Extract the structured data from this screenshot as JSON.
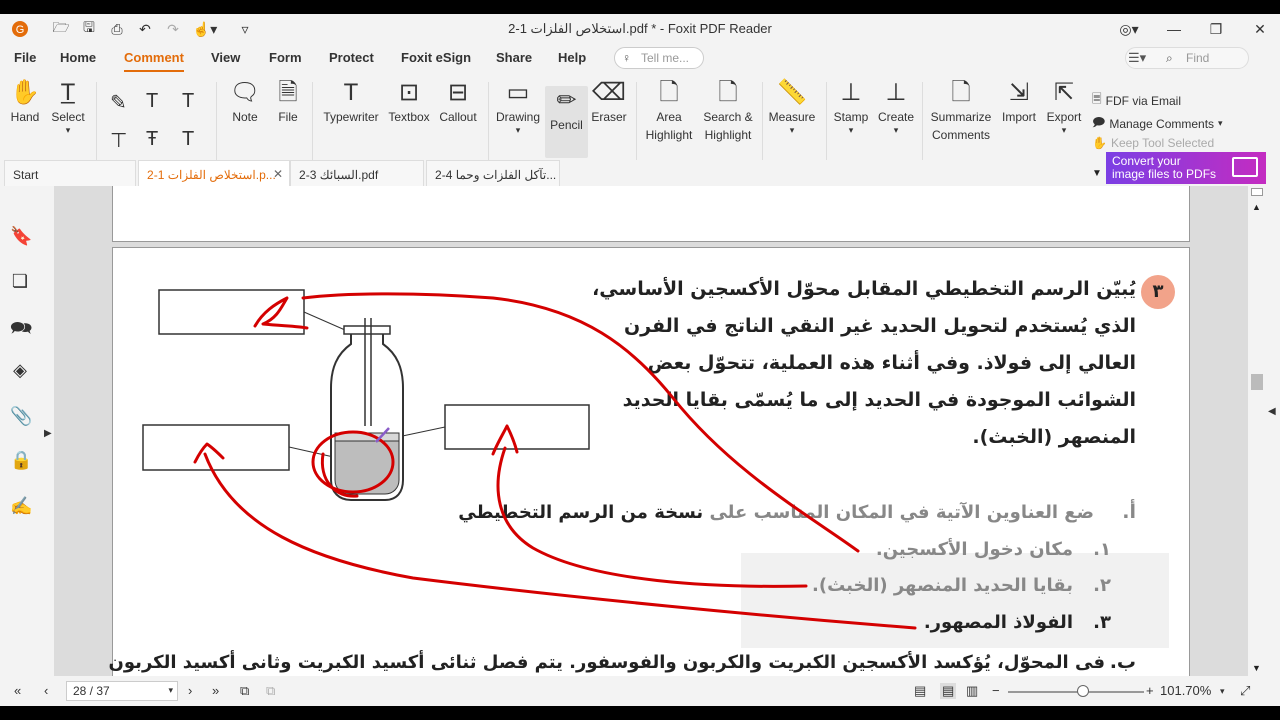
{
  "window": {
    "title": "استخلاص الفلزات 1-2.pdf * - Foxit PDF Reader"
  },
  "menu": [
    "File",
    "Home",
    "Comment",
    "View",
    "Form",
    "Protect",
    "Foxit eSign",
    "Share",
    "Help"
  ],
  "active_menu": "Comment",
  "tell_me": "Tell me...",
  "find": "Find",
  "ribbon": {
    "hand": "Hand",
    "select": "Select",
    "note": "Note",
    "file": "File",
    "typewriter": "Typewriter",
    "textbox": "Textbox",
    "callout": "Callout",
    "drawing": "Drawing",
    "pencil": "Pencil",
    "eraser": "Eraser",
    "area_highlight_1": "Area",
    "area_highlight_2": "Highlight",
    "search_highlight_1": "Search &",
    "search_highlight_2": "Highlight",
    "measure": "Measure",
    "stamp": "Stamp",
    "create": "Create",
    "summarize_1": "Summarize",
    "summarize_2": "Comments",
    "import": "Import",
    "export": "Export",
    "fdf_email": "FDF via Email",
    "manage_comments": "Manage Comments",
    "keep_tool": "Keep Tool Selected"
  },
  "tabs": [
    {
      "label": "Start"
    },
    {
      "label": "استخلاص الفلزات 1-2.p..."
    },
    {
      "label": "السبائك 3-2.pdf"
    },
    {
      "label": "تآكل الفلزات وحما 4-2..."
    }
  ],
  "banner": {
    "line1": "Convert your",
    "line2": "image files to PDFs"
  },
  "doc": {
    "qnum": "٣",
    "lines": [
      "يُبيّن الرسم التخطيطي المقابل محوّل الأكسجين الأساسي،",
      "الذي يُستخدم لتحويل الحديد غير النقي الناتج في الفرن",
      "العالي إلى فولاذ. وفي أثناء هذه العملية، تتحوّل بعض",
      "الشوائب الموجودة في الحديد إلى ما يُسمّى بقايا الحديد",
      "المنصهر (الخبث)."
    ],
    "part_a_label": "أ.",
    "part_a_grey": "ضع العناوين الآتية في المكان المناسب على",
    "part_a_dark": "نسخة من الرسم التخطيطي",
    "items": [
      {
        "num": "١.",
        "text": "مكان دخول الأكسجين."
      },
      {
        "num": "٢.",
        "text": "بقايا الحديد المنصهر (الخبث)."
      },
      {
        "num": "٣.",
        "text": "الفولاذ المصهور."
      }
    ],
    "part_b_label": "ب.",
    "part_b_text": "فى المحوّل، يُؤكسد الأكسجين الكبريت والكربون والفوسفور. يتم فصل ثنائى أكسيد الكبريت وثانى أكسيد الكربون"
  },
  "status": {
    "page": "28 / 37",
    "zoom": "101.70%",
    "zoom_level": 0.55
  },
  "colors": {
    "accent": "#e36c0a",
    "ink": "#d40000",
    "qnum_bg": "#f2a38a"
  }
}
